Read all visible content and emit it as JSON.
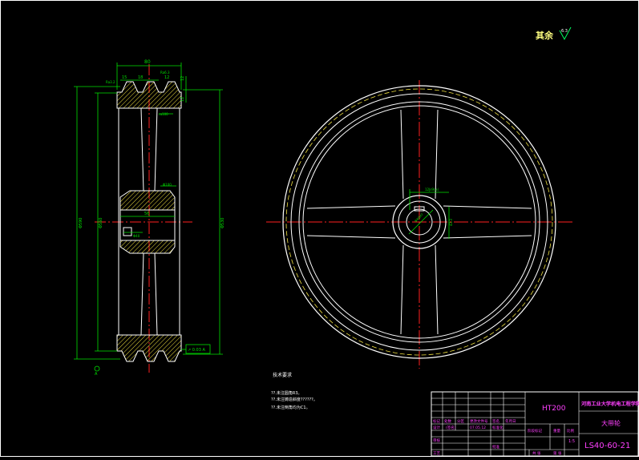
{
  "roughness": {
    "label": "其余",
    "value": "6.3"
  },
  "side_view": {
    "dim_width": "80",
    "dim_top_a": "15",
    "dim_top_b": "18",
    "dim_top_c": "12",
    "dim_right_a": "12",
    "dim_right_b": "12",
    "dim_r1": "Ra3.2",
    "dim_r2": "Ra6.3",
    "dim_hub_w": "56",
    "dim_outer": "Φ590",
    "dim_mid": "Φ560",
    "dim_inner": "Φ530",
    "dim_hub_dia": "Φ100",
    "dim_bore": "Φ40",
    "dim_rim": "ra100",
    "tol_frame": "↗ 0.03 A",
    "datum": "A"
  },
  "front_view": {
    "keyway_w": "12Js9(±)",
    "keyway_d": "43.3",
    "bore": "Φ40H7"
  },
  "notes": {
    "title": "技术要求",
    "lines": [
      "??.未注圆角R3。",
      "??.未注铸造斜度??????。",
      "??.未注倒角均为C1。"
    ]
  },
  "title_block": {
    "material": "HT200",
    "org": "河南工业大学机电工程学院",
    "part_name": "大带轮",
    "drawing_no": "LS40-60-21",
    "scale": "1:5",
    "headers": [
      "标记",
      "处数",
      "分区",
      "更改文件号",
      "签名",
      "年月日"
    ],
    "row_design": [
      "设计",
      "(签名)",
      "07.05.12",
      "标准化"
    ],
    "row_check": "审核",
    "row_process": "工艺",
    "row_approve": "批准",
    "stage_label": "阶段标记",
    "weight_label": "重量",
    "scale_label": "比例",
    "sheet_total": "共 张",
    "sheet_no": "第 张"
  },
  "colors": {
    "line_white": "#ffffff",
    "center_red": "#ff2020",
    "dim_green": "#00e000",
    "hatch_yellow": "#f0e040",
    "text_magenta": "#ff40ff",
    "frame_green": "#00c000"
  }
}
